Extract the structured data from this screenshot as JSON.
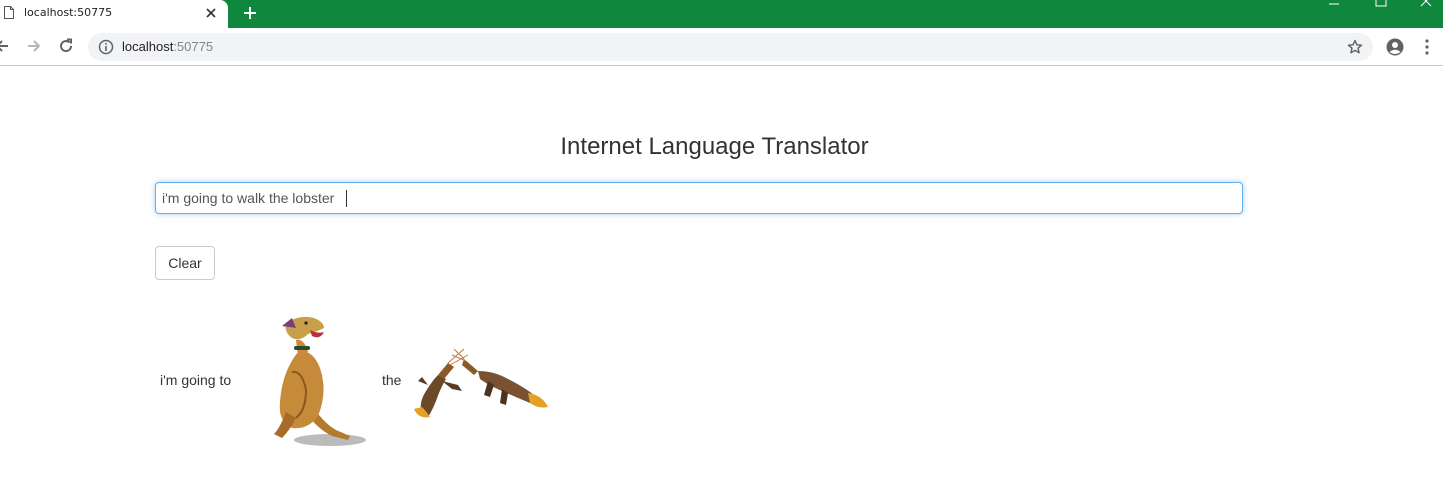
{
  "browser": {
    "tab_title": "localhost:50775",
    "url_host": "localhost",
    "url_port": ":50775",
    "accent_color": "#0f883d"
  },
  "icons": {
    "tab": "page-icon",
    "close": "close-icon",
    "new_tab": "plus-icon",
    "back": "arrow-left-icon",
    "forward": "arrow-right-icon",
    "reload": "reload-icon",
    "info": "info-icon",
    "bookmark": "star-icon",
    "profile": "account-icon",
    "menu": "kebab-menu-icon"
  },
  "page": {
    "title": "Internet Language Translator",
    "input_value": "i'm going to walk the lobster ",
    "clear_label": "Clear",
    "translation": {
      "segment_1": "i'm going to",
      "segment_2": "the"
    }
  },
  "colors": {
    "input_focus_border": "#66afe9",
    "text": "#333333"
  }
}
